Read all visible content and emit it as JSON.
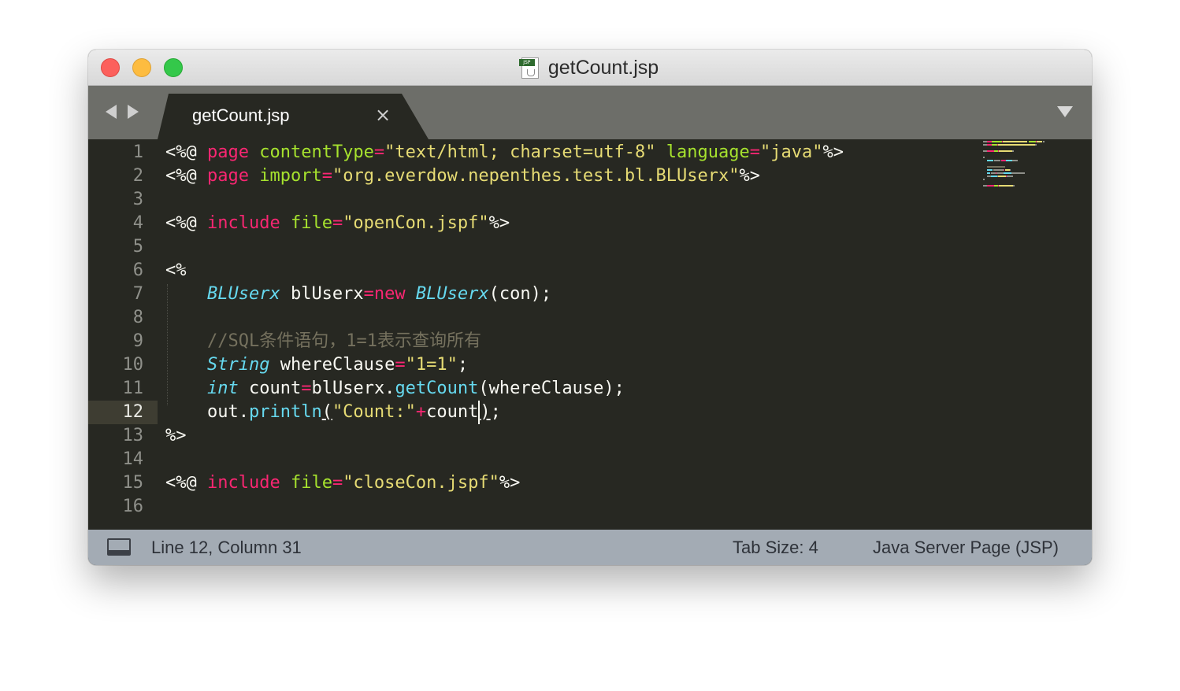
{
  "window": {
    "title": "getCount.jsp",
    "file_icon_tag": "JSP"
  },
  "tabs": [
    {
      "label": "getCount.jsp",
      "close_glyph": "×"
    }
  ],
  "editor": {
    "active_line": 12,
    "line_numbers": [
      "1",
      "2",
      "3",
      "4",
      "5",
      "6",
      "7",
      "8",
      "9",
      "10",
      "11",
      "12",
      "13",
      "14",
      "15",
      "16"
    ],
    "lines": [
      [
        {
          "t": "<%@ ",
          "c": "w"
        },
        {
          "t": "page ",
          "c": "k"
        },
        {
          "t": "contentType",
          "c": "a"
        },
        {
          "t": "=",
          "c": "k"
        },
        {
          "t": "\"text/html; charset=utf-8\"",
          "c": "s"
        },
        {
          "t": " ",
          "c": "w"
        },
        {
          "t": "language",
          "c": "a"
        },
        {
          "t": "=",
          "c": "k"
        },
        {
          "t": "\"java\"",
          "c": "s"
        },
        {
          "t": "%>",
          "c": "w"
        }
      ],
      [
        {
          "t": "<%@ ",
          "c": "w"
        },
        {
          "t": "page ",
          "c": "k"
        },
        {
          "t": "import",
          "c": "a"
        },
        {
          "t": "=",
          "c": "k"
        },
        {
          "t": "\"org.everdow.nepenthes.test.bl.BLUserx\"",
          "c": "s"
        },
        {
          "t": "%>",
          "c": "w"
        }
      ],
      [],
      [
        {
          "t": "<%@ ",
          "c": "w"
        },
        {
          "t": "include ",
          "c": "k"
        },
        {
          "t": "file",
          "c": "a"
        },
        {
          "t": "=",
          "c": "k"
        },
        {
          "t": "\"openCon.jspf\"",
          "c": "s"
        },
        {
          "t": "%>",
          "c": "w"
        }
      ],
      [],
      [
        {
          "t": "<%",
          "c": "w"
        }
      ],
      [
        {
          "t": "    ",
          "c": "w"
        },
        {
          "t": "BLUserx",
          "c": "t"
        },
        {
          "t": " blUserx",
          "c": "w"
        },
        {
          "t": "=",
          "c": "k"
        },
        {
          "t": "new ",
          "c": "k"
        },
        {
          "t": "BLUserx",
          "c": "t"
        },
        {
          "t": "(con);",
          "c": "w"
        }
      ],
      [],
      [
        {
          "t": "    ",
          "c": "w"
        },
        {
          "t": "//SQL条件语句，1=1表示查询所有",
          "c": "c"
        }
      ],
      [
        {
          "t": "    ",
          "c": "w"
        },
        {
          "t": "String",
          "c": "t"
        },
        {
          "t": " whereClause",
          "c": "w"
        },
        {
          "t": "=",
          "c": "k"
        },
        {
          "t": "\"1=1\"",
          "c": "s"
        },
        {
          "t": ";",
          "c": "w"
        }
      ],
      [
        {
          "t": "    ",
          "c": "w"
        },
        {
          "t": "int",
          "c": "t"
        },
        {
          "t": " count",
          "c": "w"
        },
        {
          "t": "=",
          "c": "k"
        },
        {
          "t": "blUserx.",
          "c": "w"
        },
        {
          "t": "getCount",
          "c": "f"
        },
        {
          "t": "(whereClause);",
          "c": "w"
        }
      ],
      [
        {
          "t": "    ",
          "c": "w"
        },
        {
          "t": "out.",
          "c": "w"
        },
        {
          "t": "println",
          "c": "f"
        },
        {
          "t": "(",
          "c": "ul"
        },
        {
          "t": "\"Count:\"",
          "c": "s"
        },
        {
          "t": "+",
          "c": "k"
        },
        {
          "t": "count",
          "c": "w"
        },
        {
          "t": "",
          "c": "cursor"
        },
        {
          "t": ")",
          "c": "ul"
        },
        {
          "t": ";",
          "c": "w"
        }
      ],
      [
        {
          "t": "%>",
          "c": "w"
        }
      ],
      [],
      [
        {
          "t": "<%@ ",
          "c": "w"
        },
        {
          "t": "include ",
          "c": "k"
        },
        {
          "t": "file",
          "c": "a"
        },
        {
          "t": "=",
          "c": "k"
        },
        {
          "t": "\"closeCon.jspf\"",
          "c": "s"
        },
        {
          "t": "%>",
          "c": "w"
        }
      ],
      []
    ]
  },
  "statusbar": {
    "position": "Line 12, Column 31",
    "tab_size": "Tab Size: 4",
    "syntax": "Java Server Page (JSP)"
  },
  "colors": {
    "background": "#272822",
    "keyword": "#f92672",
    "attribute": "#a6e22e",
    "string": "#e6db74",
    "type": "#66d9ef",
    "comment": "#75715e",
    "text": "#f8f8f2",
    "tabbar": "#6d6e69",
    "statusbar": "#a3abb4"
  }
}
